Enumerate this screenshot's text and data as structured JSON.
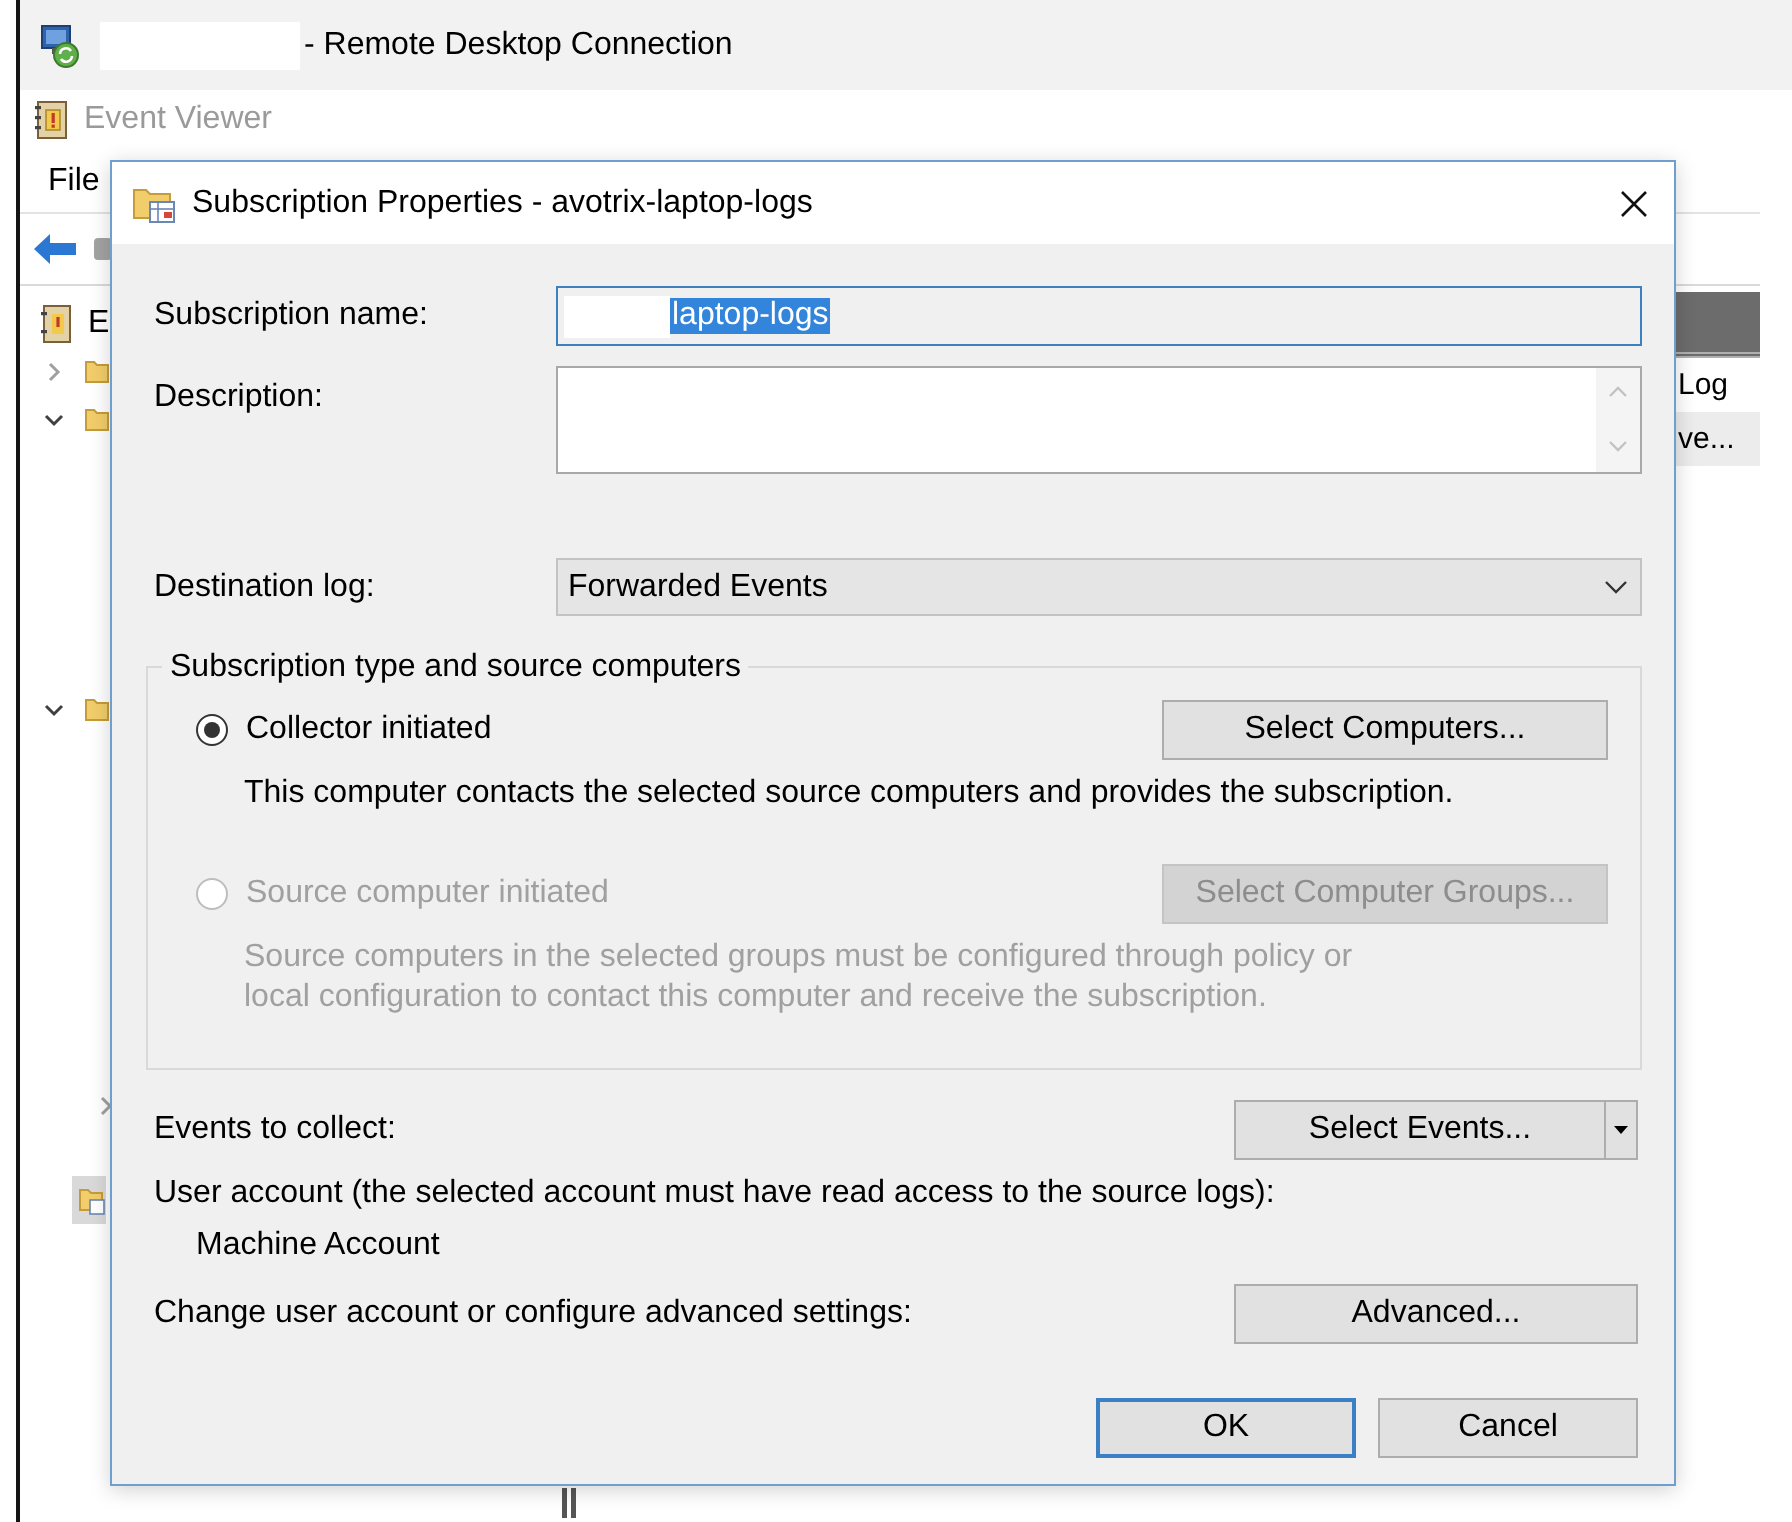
{
  "remote_desktop": {
    "title": "- Remote Desktop Connection",
    "redacted": true
  },
  "event_viewer": {
    "title": "Event Viewer",
    "menu": [
      "File"
    ],
    "tree": [
      {
        "kind": "root",
        "label": "E",
        "selected": false,
        "children": [
          {
            "kind": "folder",
            "expanded": false,
            "selected": false
          },
          {
            "kind": "folder",
            "expanded": true,
            "selected": false
          },
          {
            "kind": "folder",
            "expanded": true,
            "selected": false,
            "children": [
              {
                "kind": "expander",
                "expanded": false,
                "selected": false
              }
            ]
          },
          {
            "kind": "item",
            "selected": true
          }
        ]
      }
    ],
    "actions": [
      {
        "label": "Log",
        "highlighted": false
      },
      {
        "label": "ve...",
        "highlighted": true
      }
    ]
  },
  "dialog": {
    "title": "Subscription Properties - avotrix-laptop-logs",
    "fields": [
      {
        "kind": "text",
        "label": "Subscription name:",
        "value": "laptop-logs",
        "redacted": true,
        "read_only": true,
        "focused": true,
        "text_selected": true
      },
      {
        "kind": "textarea",
        "label": "Description:"
      },
      {
        "kind": "select",
        "label": "Destination log:",
        "value": "Forwarded Events"
      }
    ],
    "group": {
      "title": "Subscription type and source computers",
      "options": [
        {
          "label": "Collector initiated",
          "selected": true,
          "disabled": false,
          "button": "Select Computers...",
          "description": [
            "This computer contacts the selected source computers and provides the subscription."
          ]
        },
        {
          "label": "Source computer initiated",
          "selected": false,
          "disabled": true,
          "button": "Select Computer Groups...",
          "description": [
            "Source computers in the selected groups must be configured through policy or",
            "local configuration to contact this computer and receive the subscription."
          ]
        }
      ]
    },
    "events": {
      "label": "Events to collect:",
      "button": "Select Events..."
    },
    "user_account": {
      "label": "User account (the selected account must have read access to the source logs):",
      "value": "Machine Account"
    },
    "advanced": {
      "label": "Change user account or configure advanced settings:",
      "button": "Advanced..."
    },
    "buttons": [
      {
        "label": "OK",
        "default": true
      },
      {
        "label": "Cancel",
        "default": false
      }
    ]
  }
}
